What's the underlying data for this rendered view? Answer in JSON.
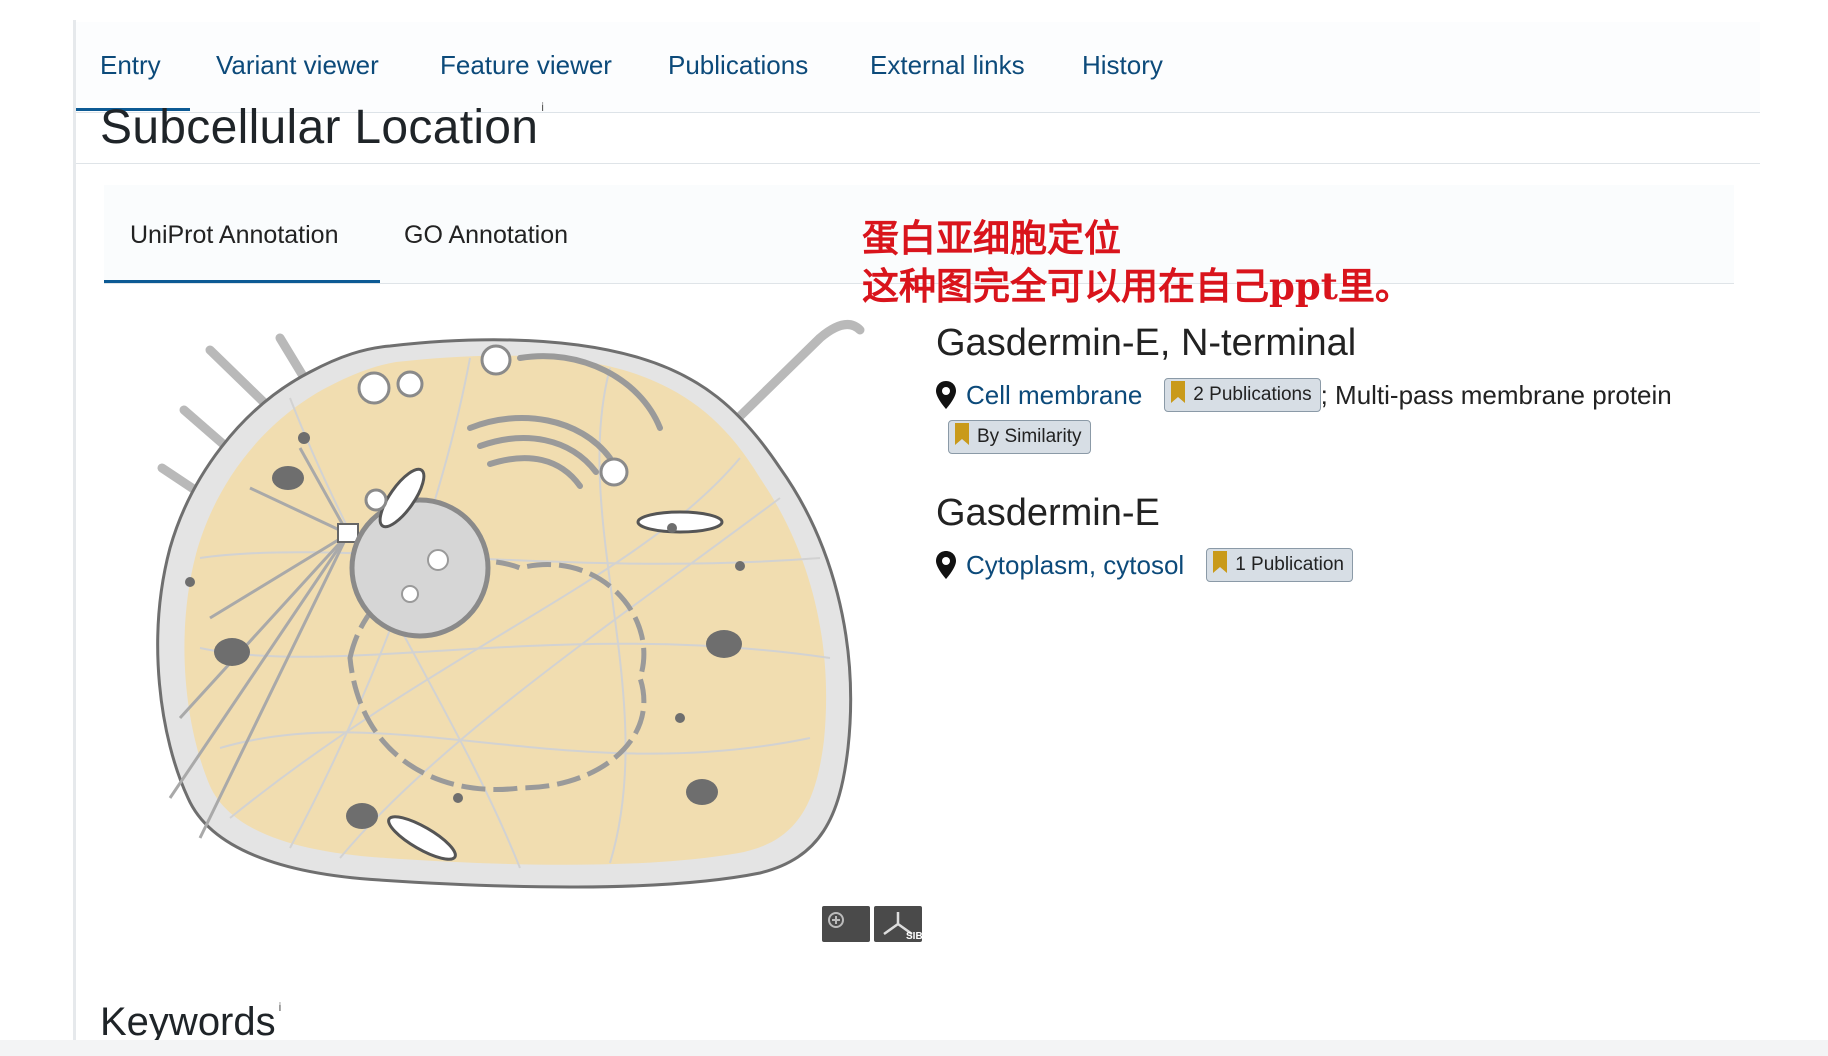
{
  "nav": {
    "tabs": [
      "Entry",
      "Variant viewer",
      "Feature viewer",
      "Publications",
      "External links",
      "History"
    ],
    "active": "Entry"
  },
  "section": {
    "title": "Subcellular Location",
    "info": "i"
  },
  "subtabs": {
    "items": [
      "UniProt Annotation",
      "GO Annotation"
    ],
    "active": "UniProt Annotation"
  },
  "annotation": {
    "line1": "蛋白亚细胞定位",
    "line2": "这种图完全可以用在自己ppt里。"
  },
  "locations": [
    {
      "name": "Gasdermin-E, N-terminal",
      "location": "Cell membrane",
      "publications": "2 Publications",
      "topology": "; Multi-pass membrane protein",
      "evidence": "By Similarity"
    },
    {
      "name": "Gasdermin-E",
      "location": "Cytoplasm, cytosol",
      "publications": "1 Publication"
    }
  ],
  "logo": {
    "text": "SIB"
  },
  "keywords": {
    "title": "Keywords",
    "info": "i"
  },
  "colors": {
    "link": "#0c4a7a",
    "accent": "#0c5a94",
    "annotation_red": "#d9141c",
    "cytoplasm": "#f1ddb0",
    "badge_bg": "#d7dee5",
    "flag": "#c99a1a"
  }
}
